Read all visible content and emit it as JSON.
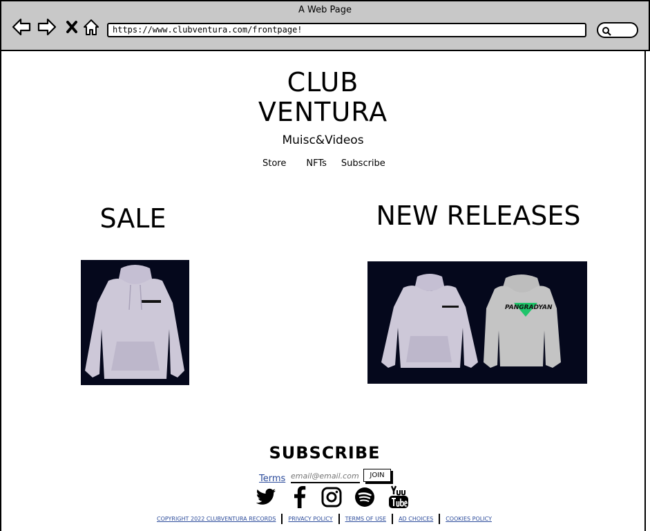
{
  "browser": {
    "window_title": "A Web Page",
    "url": "https://www.clubventura.com/frontpage!"
  },
  "site": {
    "logo_line1": "CLUB",
    "logo_line2": "VENTURA",
    "tagline": "Muisc&Videos",
    "nav": [
      "Store",
      "NFTs",
      "Subscribe"
    ]
  },
  "sections": {
    "sale_title": "SALE",
    "new_releases_title": "NEW RELEASES",
    "new_release_print": "PANGRADYAN"
  },
  "subscribe": {
    "title": "SUBSCRIBE",
    "terms_label": "Terms",
    "email_placeholder": "email@email.com",
    "join_label": "JOIN"
  },
  "social": [
    "twitter-icon",
    "facebook-icon",
    "instagram-icon",
    "spotify-icon",
    "youtube-icon"
  ],
  "footer": {
    "links": [
      "COPYRIGHT 2022 CLUBVENTURA RECORDS",
      "PRIVACY POLICY",
      "TERMS OF USE",
      "AD CHOICES",
      "COOKIES POLICY"
    ]
  },
  "colors": {
    "chrome_bg": "#c8c8c8",
    "product_bg": "#05081c",
    "hoodie_lilac": "#cdc8d8",
    "hoodie_grey": "#c4c4c4",
    "logo_green": "#1fc46a",
    "link_blue": "#2a4a9a"
  }
}
